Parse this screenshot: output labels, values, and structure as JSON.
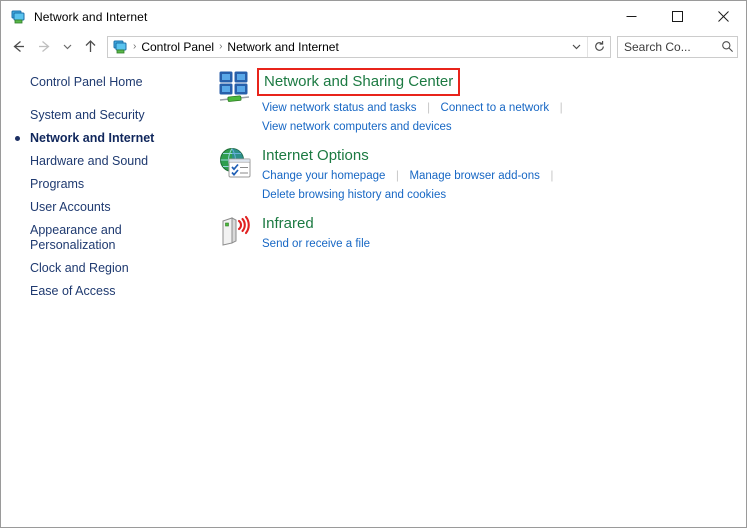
{
  "window": {
    "title": "Network and Internet",
    "title_icon": "network-folder-icon",
    "minimize_label": "Minimize",
    "maximize_label": "Maximize",
    "close_label": "Close"
  },
  "toolbar": {
    "back_label": "Back",
    "forward_label": "Forward",
    "recent_label": "Recent locations",
    "up_label": "Up one level",
    "address_icon": "network-folder-icon",
    "breadcrumbs": [
      {
        "label": "Control Panel"
      },
      {
        "label": "Network and Internet"
      }
    ],
    "separator": "›",
    "dropdown_icon": "chevron-down-icon",
    "refresh_icon": "refresh-icon",
    "search_placeholder": "Search Co...",
    "search_value": "",
    "search_icon": "magnifier-icon"
  },
  "sidebar": {
    "home": {
      "label": "Control Panel Home"
    },
    "items": [
      {
        "label": "System and Security",
        "active": false
      },
      {
        "label": "Network and Internet",
        "active": true
      },
      {
        "label": "Hardware and Sound",
        "active": false
      },
      {
        "label": "Programs",
        "active": false
      },
      {
        "label": "User Accounts",
        "active": false
      },
      {
        "label": "Appearance and Personalization",
        "active": false
      },
      {
        "label": "Clock and Region",
        "active": false
      },
      {
        "label": "Ease of Access",
        "active": false
      }
    ]
  },
  "main": {
    "categories": [
      {
        "title": "Network and Sharing Center",
        "icon": "network-sharing-center-icon",
        "highlighted": true,
        "rows": [
          [
            "View network status and tasks",
            "Connect to a network"
          ],
          [
            "View network computers and devices"
          ]
        ]
      },
      {
        "title": "Internet Options",
        "icon": "internet-options-icon",
        "highlighted": false,
        "rows": [
          [
            "Change your homepage",
            "Manage browser add-ons"
          ],
          [
            "Delete browsing history and cookies"
          ]
        ]
      },
      {
        "title": "Infrared",
        "icon": "infrared-icon",
        "highlighted": false,
        "rows": [
          [
            "Send or receive a file"
          ]
        ]
      }
    ]
  },
  "colors": {
    "heading_green": "#1c7a42",
    "link_blue": "#1767c4",
    "highlight_red": "#e8241b",
    "sidebar_navy": "#1f3a70"
  }
}
